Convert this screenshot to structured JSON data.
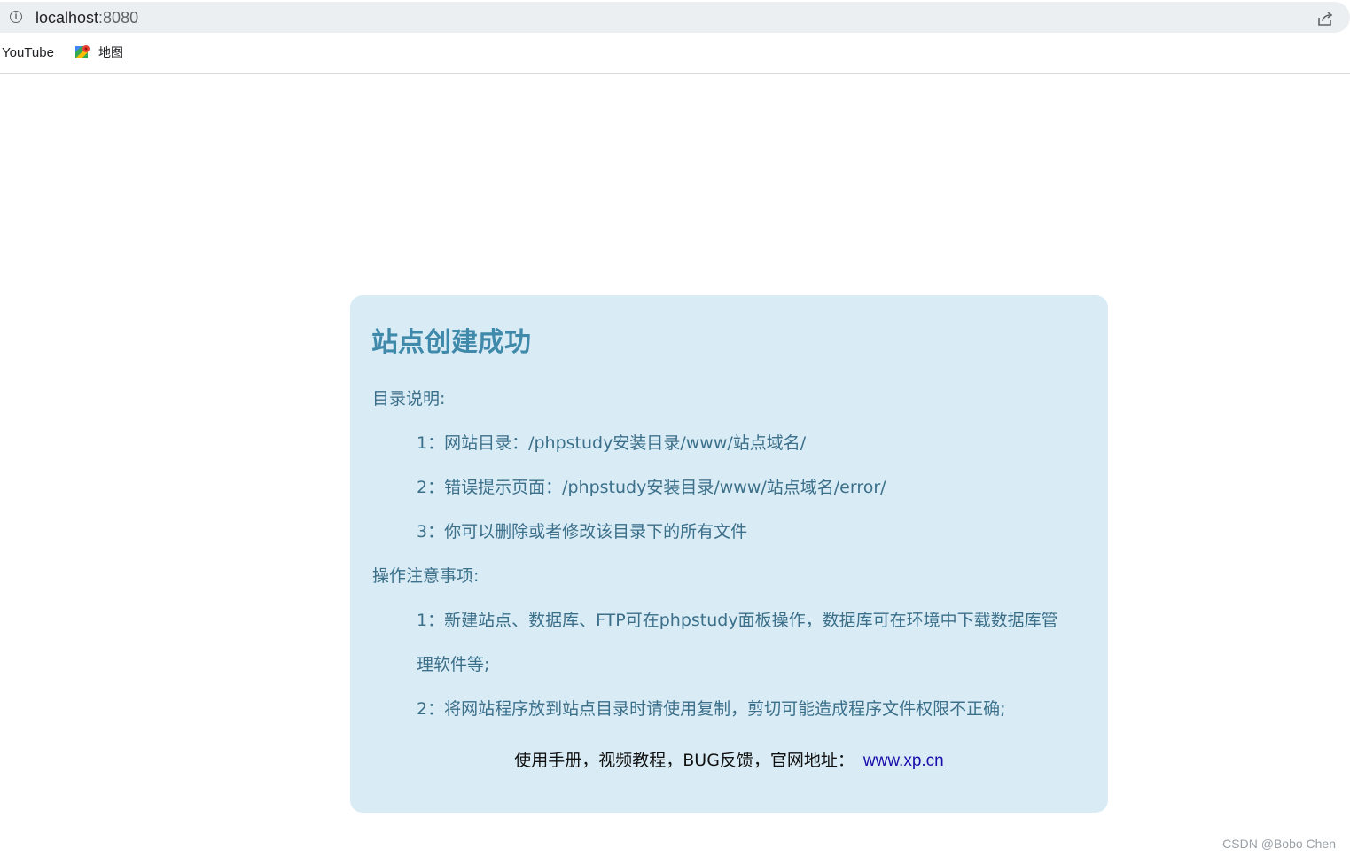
{
  "browser": {
    "url_host": "localhost",
    "url_port": ":8080",
    "bookmarks": [
      {
        "label": "YouTube"
      },
      {
        "label": "地图"
      }
    ]
  },
  "card": {
    "title": "站点创建成功",
    "dir_heading": "目录说明:",
    "dir_items": [
      "1：网站目录：/phpstudy安装目录/www/站点域名/",
      "2：错误提示页面：/phpstudy安装目录/www/站点域名/error/",
      "3：你可以删除或者修改该目录下的所有文件"
    ],
    "ops_heading": "操作注意事项:",
    "ops_items": [
      "1：新建站点、数据库、FTP可在phpstudy面板操作，数据库可在环境中下载数据库管",
      "理软件等;",
      "2：将网站程序放到站点目录时请使用复制，剪切可能造成程序文件权限不正确;"
    ],
    "footer_text": "使用手册，视频教程，BUG反馈，官网地址：",
    "footer_link": "www.xp.cn"
  },
  "watermark": "CSDN @Bobo Chen",
  "colors": {
    "card_bg": "#d9ecf5",
    "title": "#3f89aa",
    "text": "#3b6f8a",
    "link": "#1a0dab"
  }
}
